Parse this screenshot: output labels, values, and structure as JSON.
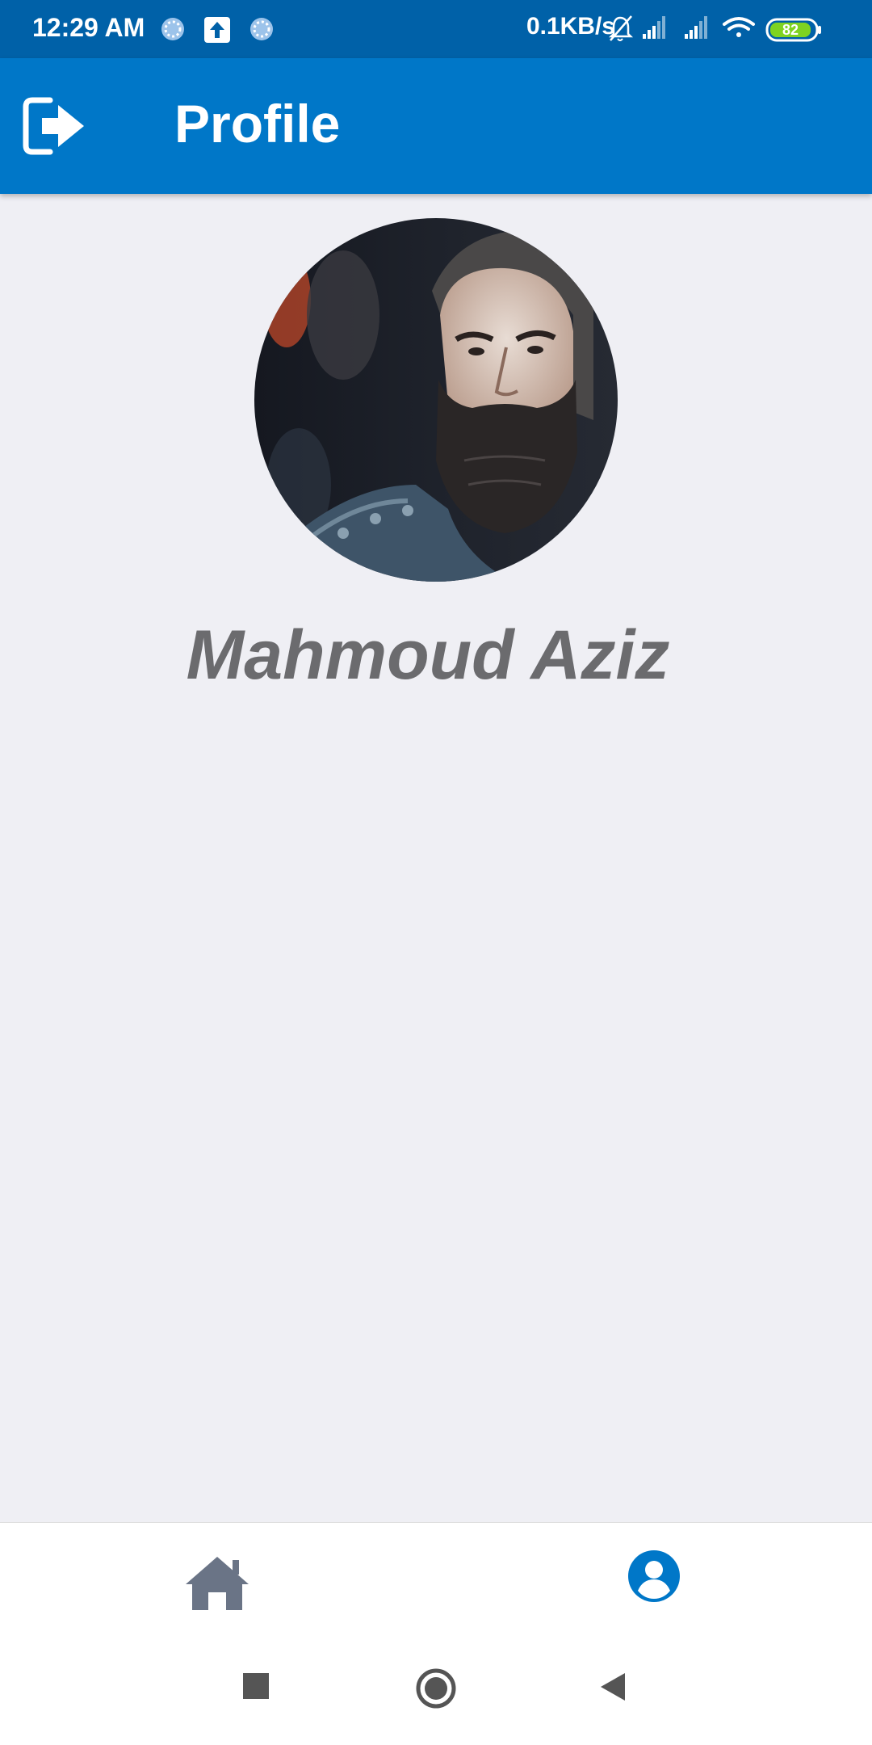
{
  "status_bar": {
    "time": "12:29 AM",
    "speed": "0.1KB/s",
    "battery": "82",
    "icons": [
      "loading-icon",
      "upload-icon",
      "loading-icon",
      "bell-muted-icon",
      "signal-icon",
      "signal-icon",
      "wifi-icon",
      "battery-icon"
    ]
  },
  "header": {
    "title": "Profile",
    "logout_icon": "logout-icon"
  },
  "profile": {
    "name": "Mahmoud Aziz"
  },
  "tabs": [
    {
      "icon": "home-icon",
      "active": false
    },
    {
      "icon": "user-circle-icon",
      "active": true
    }
  ],
  "colors": {
    "status_bar": "#0061a8",
    "app_bar": "#0077c8",
    "active_tab": "#0077c8",
    "inactive_tab": "#6a7486",
    "name_text": "#6b6b6e",
    "background": "#efeff4"
  },
  "system_nav": [
    "square-icon",
    "circle-icon",
    "back-triangle-icon"
  ]
}
